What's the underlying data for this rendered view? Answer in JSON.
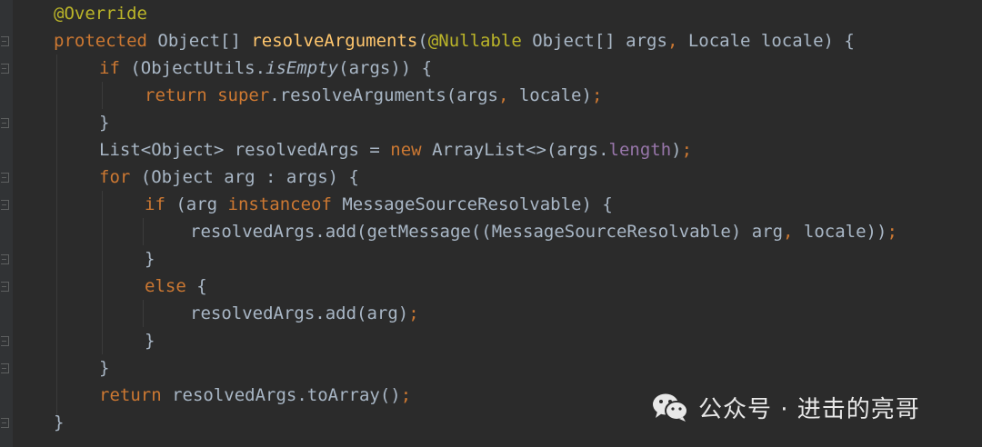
{
  "code": {
    "lines": [
      [
        {
          "t": "@Override",
          "c": "ann"
        }
      ],
      [
        {
          "t": "protected",
          "c": "kw"
        },
        {
          "t": " Object[] ",
          "c": "txt"
        },
        {
          "t": "resolveArguments",
          "c": "fn"
        },
        {
          "t": "(",
          "c": "txt"
        },
        {
          "t": "@Nullable",
          "c": "ann"
        },
        {
          "t": " Object[] args",
          "c": "txt"
        },
        {
          "t": ",",
          "c": "kw"
        },
        {
          "t": " Locale locale) {",
          "c": "txt"
        }
      ],
      [
        {
          "t": "if",
          "c": "kw"
        },
        {
          "t": " (ObjectUtils.",
          "c": "txt"
        },
        {
          "t": "isEmpty",
          "c": "ital"
        },
        {
          "t": "(args)) {",
          "c": "txt"
        }
      ],
      [
        {
          "t": "return",
          "c": "kw"
        },
        {
          "t": " ",
          "c": "txt"
        },
        {
          "t": "super",
          "c": "kw"
        },
        {
          "t": ".resolveArguments(args",
          "c": "txt"
        },
        {
          "t": ",",
          "c": "kw"
        },
        {
          "t": " locale)",
          "c": "txt"
        },
        {
          "t": ";",
          "c": "kw"
        }
      ],
      [
        {
          "t": "}",
          "c": "txt"
        }
      ],
      [
        {
          "t": "List<Object> resolvedArgs = ",
          "c": "txt"
        },
        {
          "t": "new",
          "c": "kw"
        },
        {
          "t": " ArrayList<>(args.",
          "c": "txt"
        },
        {
          "t": "length",
          "c": "field"
        },
        {
          "t": ")",
          "c": "txt"
        },
        {
          "t": ";",
          "c": "kw"
        }
      ],
      [
        {
          "t": "for",
          "c": "kw"
        },
        {
          "t": " (Object arg : args) {",
          "c": "txt"
        }
      ],
      [
        {
          "t": "if",
          "c": "kw"
        },
        {
          "t": " (arg ",
          "c": "txt"
        },
        {
          "t": "instanceof",
          "c": "kw"
        },
        {
          "t": " MessageSourceResolvable) {",
          "c": "txt"
        }
      ],
      [
        {
          "t": "resolvedArgs.add(getMessage((MessageSourceResolvable) arg",
          "c": "txt"
        },
        {
          "t": ",",
          "c": "kw"
        },
        {
          "t": " locale))",
          "c": "txt"
        },
        {
          "t": ";",
          "c": "kw"
        }
      ],
      [
        {
          "t": "}",
          "c": "txt"
        }
      ],
      [
        {
          "t": "else",
          "c": "kw"
        },
        {
          "t": " {",
          "c": "txt"
        }
      ],
      [
        {
          "t": "resolvedArgs.add(arg)",
          "c": "txt"
        },
        {
          "t": ";",
          "c": "kw"
        }
      ],
      [
        {
          "t": "}",
          "c": "txt"
        }
      ],
      [
        {
          "t": "}",
          "c": "txt"
        }
      ],
      [
        {
          "t": "return",
          "c": "kw"
        },
        {
          "t": " resolvedArgs.toArray()",
          "c": "txt"
        },
        {
          "t": ";",
          "c": "kw"
        }
      ],
      [
        {
          "t": "}",
          "c": "txt"
        }
      ]
    ]
  },
  "watermark": {
    "icon": "wechat-icon",
    "text": "公众号 · 进击的亮哥"
  },
  "colors": {
    "background": "#2b2b2b",
    "keyword": "#cc7832",
    "annotation": "#bbb529",
    "method": "#ffc66d",
    "field": "#9876aa",
    "text": "#a9b7c6"
  }
}
